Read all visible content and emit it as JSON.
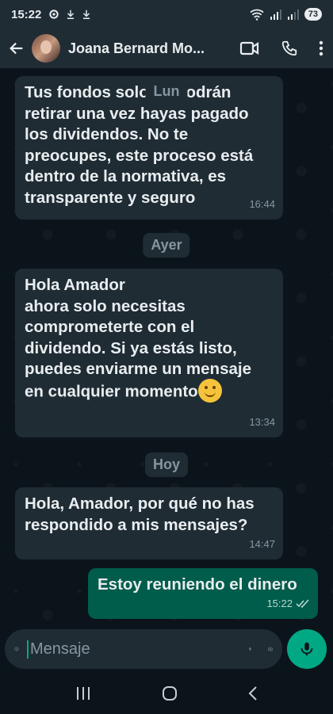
{
  "status_bar": {
    "time": "15:22",
    "battery": "73",
    "icons": [
      "settings-gear-icon",
      "download-icon",
      "download-icon",
      "wifi-icon",
      "signal-icon",
      "signal-icon",
      "battery-icon"
    ]
  },
  "header": {
    "contact_name": "Joana Bernard Mo...",
    "icons": [
      "back-arrow-icon",
      "avatar",
      "video-call-icon",
      "phone-icon",
      "more-vert-icon"
    ]
  },
  "chat": {
    "day_labels": {
      "lun": "Lun",
      "ayer": "Ayer",
      "hoy": "Hoy"
    },
    "messages": [
      {
        "direction": "in",
        "text": "Tus fondos solo se podrán retirar una vez hayas pagado los dividendos. No te preocupes, este proceso está dentro de la normativa, es transparente y seguro",
        "time": "16:44"
      },
      {
        "direction": "in",
        "text_line1": "Hola Amador",
        "text_line2": "ahora solo necesitas comprometerte con el dividendo. Si ya estás listo, puedes enviarme un mensaje en cualquier momento",
        "emoji": "smiling-face-emoji",
        "time": "13:34"
      },
      {
        "direction": "in",
        "text": "Hola, Amador, por qué no has respondido a mis mensajes?",
        "time": "14:47"
      },
      {
        "direction": "out",
        "text": "Estoy reuniendo el dinero",
        "time": "15:22",
        "status": "read-double-check-icon"
      }
    ]
  },
  "composer": {
    "placeholder": "Mensaje",
    "icons": [
      "emoji-sticker-icon",
      "attach-icon",
      "camera-icon",
      "mic-icon"
    ]
  },
  "nav": {
    "icons": [
      "recents-icon",
      "home-icon",
      "back-icon"
    ]
  },
  "colors": {
    "background": "#0b141a",
    "bar": "#1f2c34",
    "bubble_in": "#1f2c34",
    "bubble_out": "#005c4b",
    "accent": "#00a884",
    "muted": "#8696a0"
  }
}
